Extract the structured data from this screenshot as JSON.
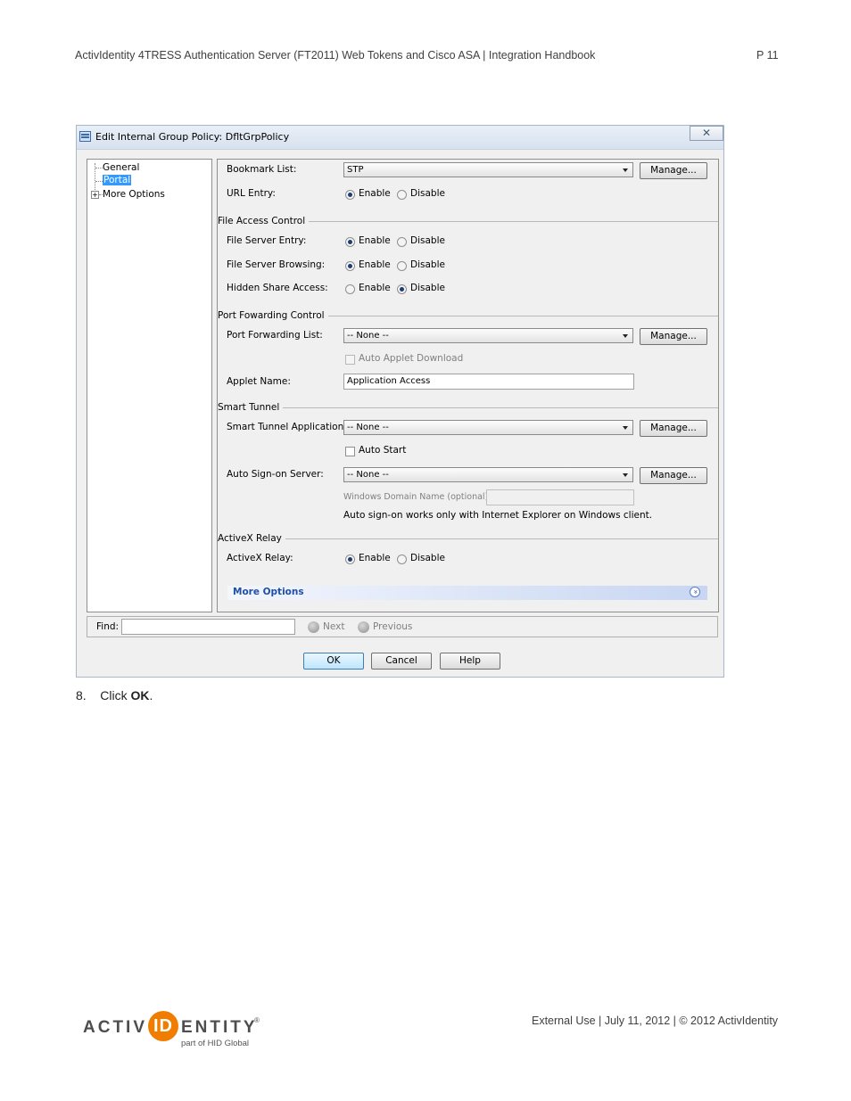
{
  "header": {
    "doc_title": "ActivIdentity 4TRESS Authentication Server (FT2011) Web Tokens and Cisco ASA | Integration Handbook",
    "page_number": "P 11"
  },
  "dialog": {
    "title": "Edit Internal Group Policy: DfltGrpPolicy",
    "close_symbol": "✕",
    "tree": {
      "items": [
        "General",
        "Portal",
        "More Options"
      ],
      "selected": "Portal",
      "expander_symbol": "+"
    },
    "portal": {
      "bookmark_list_label": "Bookmark List:",
      "bookmark_list_value": "STP",
      "manage_label": "Manage...",
      "url_entry_label": "URL Entry:",
      "enable_label": "Enable",
      "disable_label": "Disable",
      "file_access_section": "File Access Control",
      "file_server_entry_label": "File Server Entry:",
      "file_server_browsing_label": "File Server Browsing:",
      "hidden_share_access_label": "Hidden Share Access:",
      "port_forwarding_section": "Port Fowarding Control",
      "port_forwarding_list_label": "Port Forwarding List:",
      "none_value": "-- None --",
      "auto_applet_download_label": "Auto Applet Download",
      "applet_name_label": "Applet Name:",
      "applet_name_value": "Application Access",
      "smart_tunnel_section": "Smart Tunnel",
      "smart_tunnel_app_label": "Smart Tunnel Application:",
      "auto_start_label": "Auto Start",
      "auto_signon_label": "Auto Sign-on Server:",
      "windows_domain_label": "Windows Domain Name (optional):",
      "auto_signon_note": "Auto sign-on works only with Internet Explorer on Windows client.",
      "activex_section": "ActiveX Relay",
      "activex_relay_label": "ActiveX Relay:",
      "more_options_label": "More Options",
      "more_options_symbol": "»"
    },
    "radios": {
      "url_entry": "Enable",
      "file_server_entry": "Enable",
      "file_server_browsing": "Enable",
      "hidden_share_access": "Disable",
      "activex_relay": "Enable"
    },
    "find": {
      "label": "Find:",
      "value": "",
      "next_label": "Next",
      "previous_label": "Previous"
    },
    "buttons": {
      "ok": "OK",
      "cancel": "Cancel",
      "help": "Help"
    }
  },
  "instruction": {
    "number": "8.",
    "text": "Click",
    "bold": "OK",
    "end": "."
  },
  "footer": {
    "logo_text_left": "ACTIV",
    "logo_text_id": "ID",
    "logo_text_right": "ENTITY",
    "logo_mark": "®",
    "logo_sub": "part of HID Global",
    "right_text": "External Use | July 11, 2012 | © 2012 ActivIdentity"
  },
  "colors": {
    "logo_orange": "#f07d00",
    "logo_gray": "#4d4d4d",
    "selection_blue": "#3399ff",
    "link_blue": "#1f4fa8"
  }
}
